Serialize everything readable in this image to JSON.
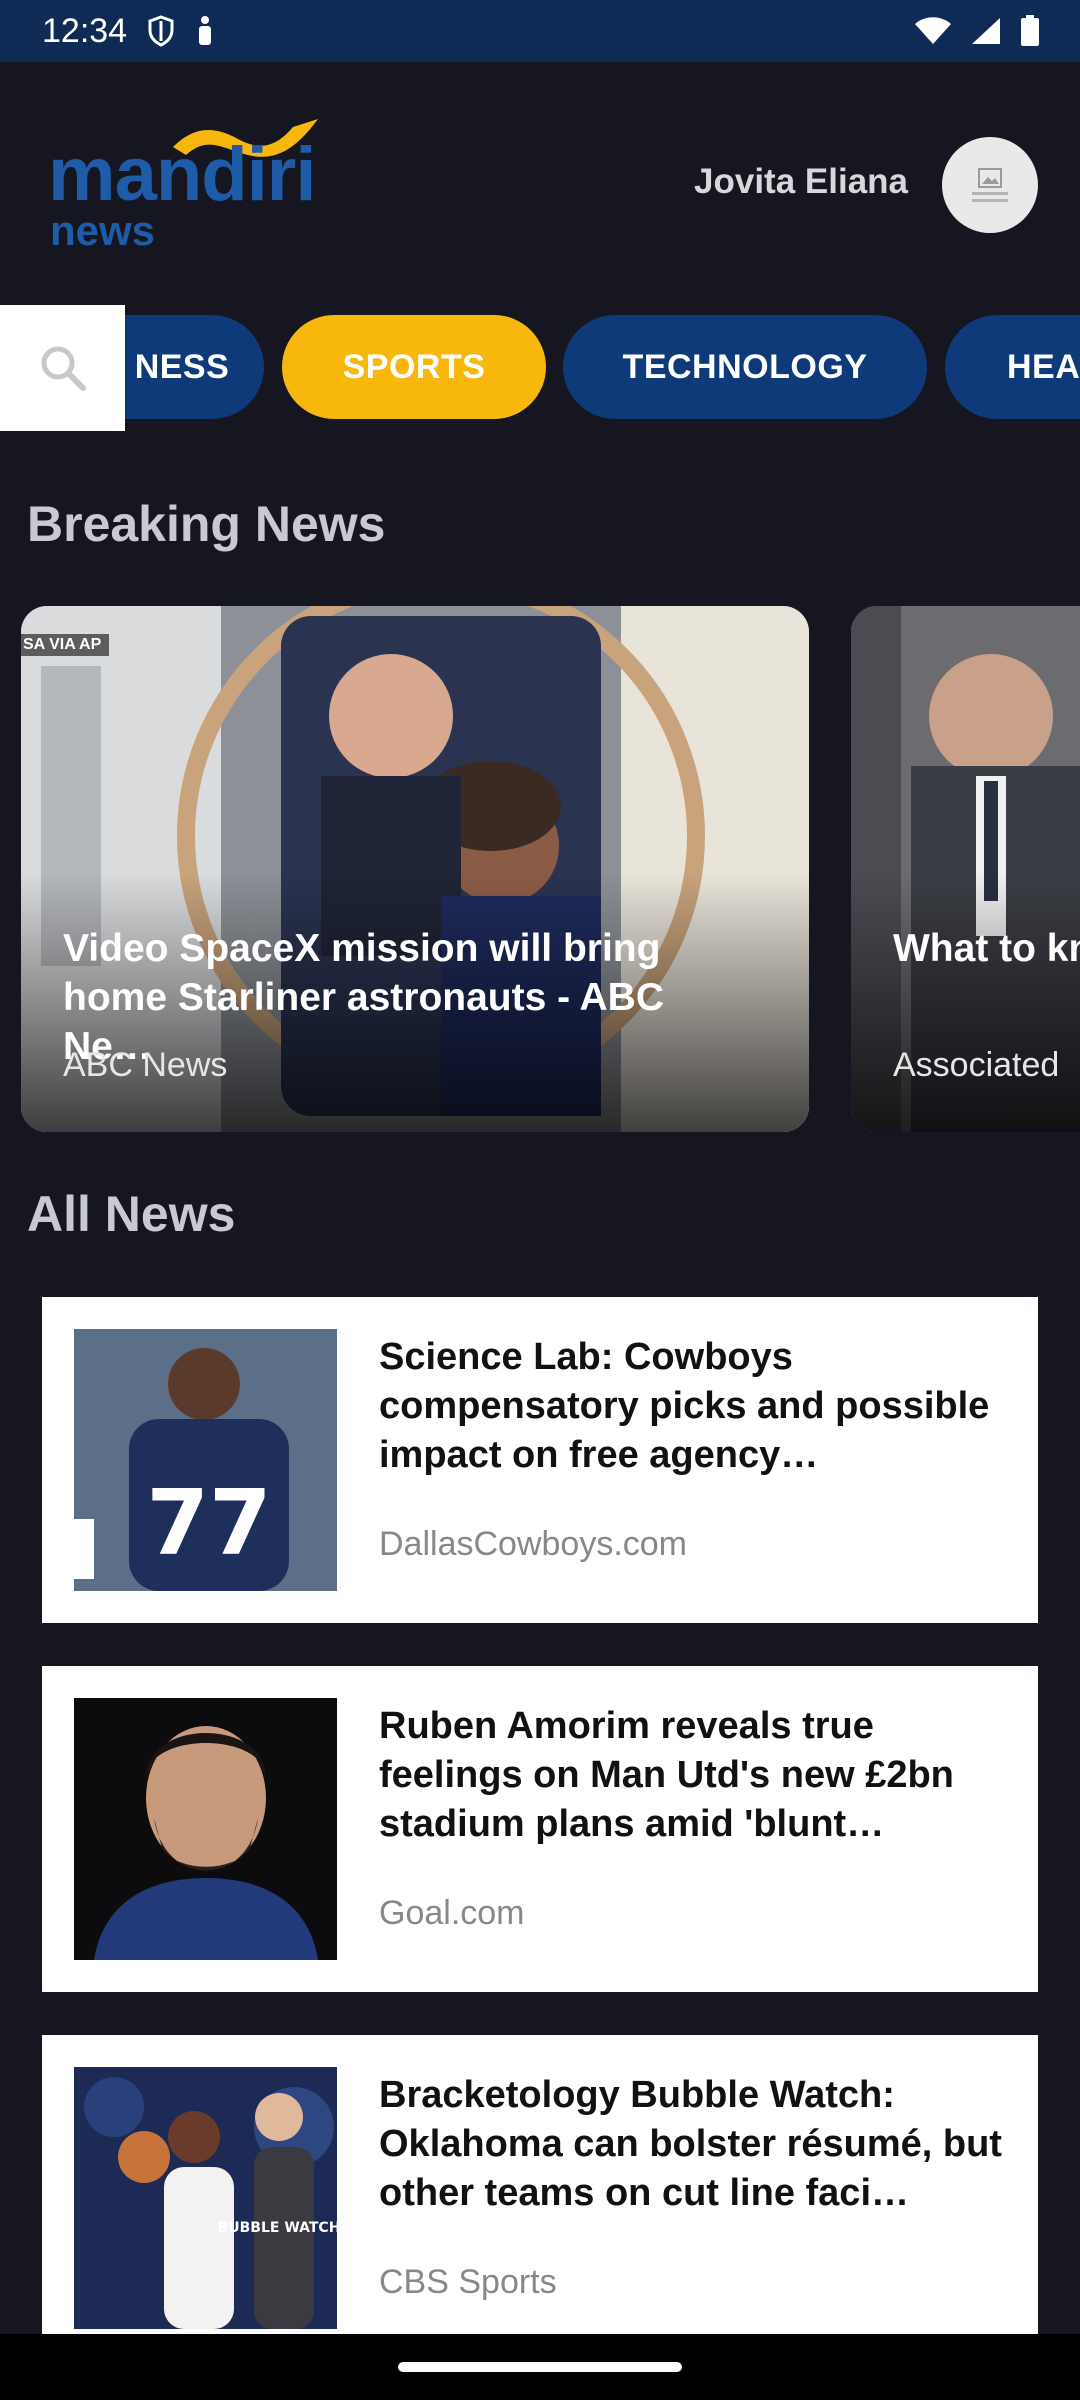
{
  "status_bar": {
    "time": "12:34"
  },
  "header": {
    "logo_line1": "mandiri",
    "logo_line2": "news",
    "user_name": "Jovita Eliana"
  },
  "categories": [
    {
      "label": "BUSINESS",
      "visible": "NESS"
    },
    {
      "label": "SPORTS",
      "selected": true
    },
    {
      "label": "TECHNOLOGY"
    },
    {
      "label": "HEALTH",
      "visible": "HEA"
    }
  ],
  "sections": {
    "breaking": "Breaking News",
    "all": "All News"
  },
  "breaking_news": [
    {
      "title": "Video SpaceX mission will bring home Starliner astronauts - ABC Ne…",
      "source": "ABC News",
      "photo_credit": "SA VIA AP"
    },
    {
      "title": "What to kn of Portuga",
      "source": "Associated"
    }
  ],
  "all_news": [
    {
      "title": "Science Lab: Cowboys compensatory picks and possible impact on free agency…",
      "source": "DallasCowboys.com",
      "jersey_number": "77"
    },
    {
      "title": "Ruben Amorim reveals true feelings on Man Utd's new £2bn stadium plans amid 'blunt…",
      "source": "Goal.com"
    },
    {
      "title": "Bracketology Bubble Watch: Oklahoma can bolster résumé, but other teams on cut line faci…",
      "source": "CBS Sports",
      "image_text": "BUBBLE WATCH"
    }
  ],
  "colors": {
    "background": "#15161f",
    "status_bar": "#0f2a54",
    "chip_default": "#0f3a7a",
    "chip_selected": "#f7b70c",
    "logo_blue": "#1e5ba8",
    "logo_swoosh": "#f7b70c"
  },
  "icons": [
    "shield-icon",
    "person-icon",
    "wifi-icon",
    "signal-icon",
    "battery-icon",
    "search-icon"
  ]
}
